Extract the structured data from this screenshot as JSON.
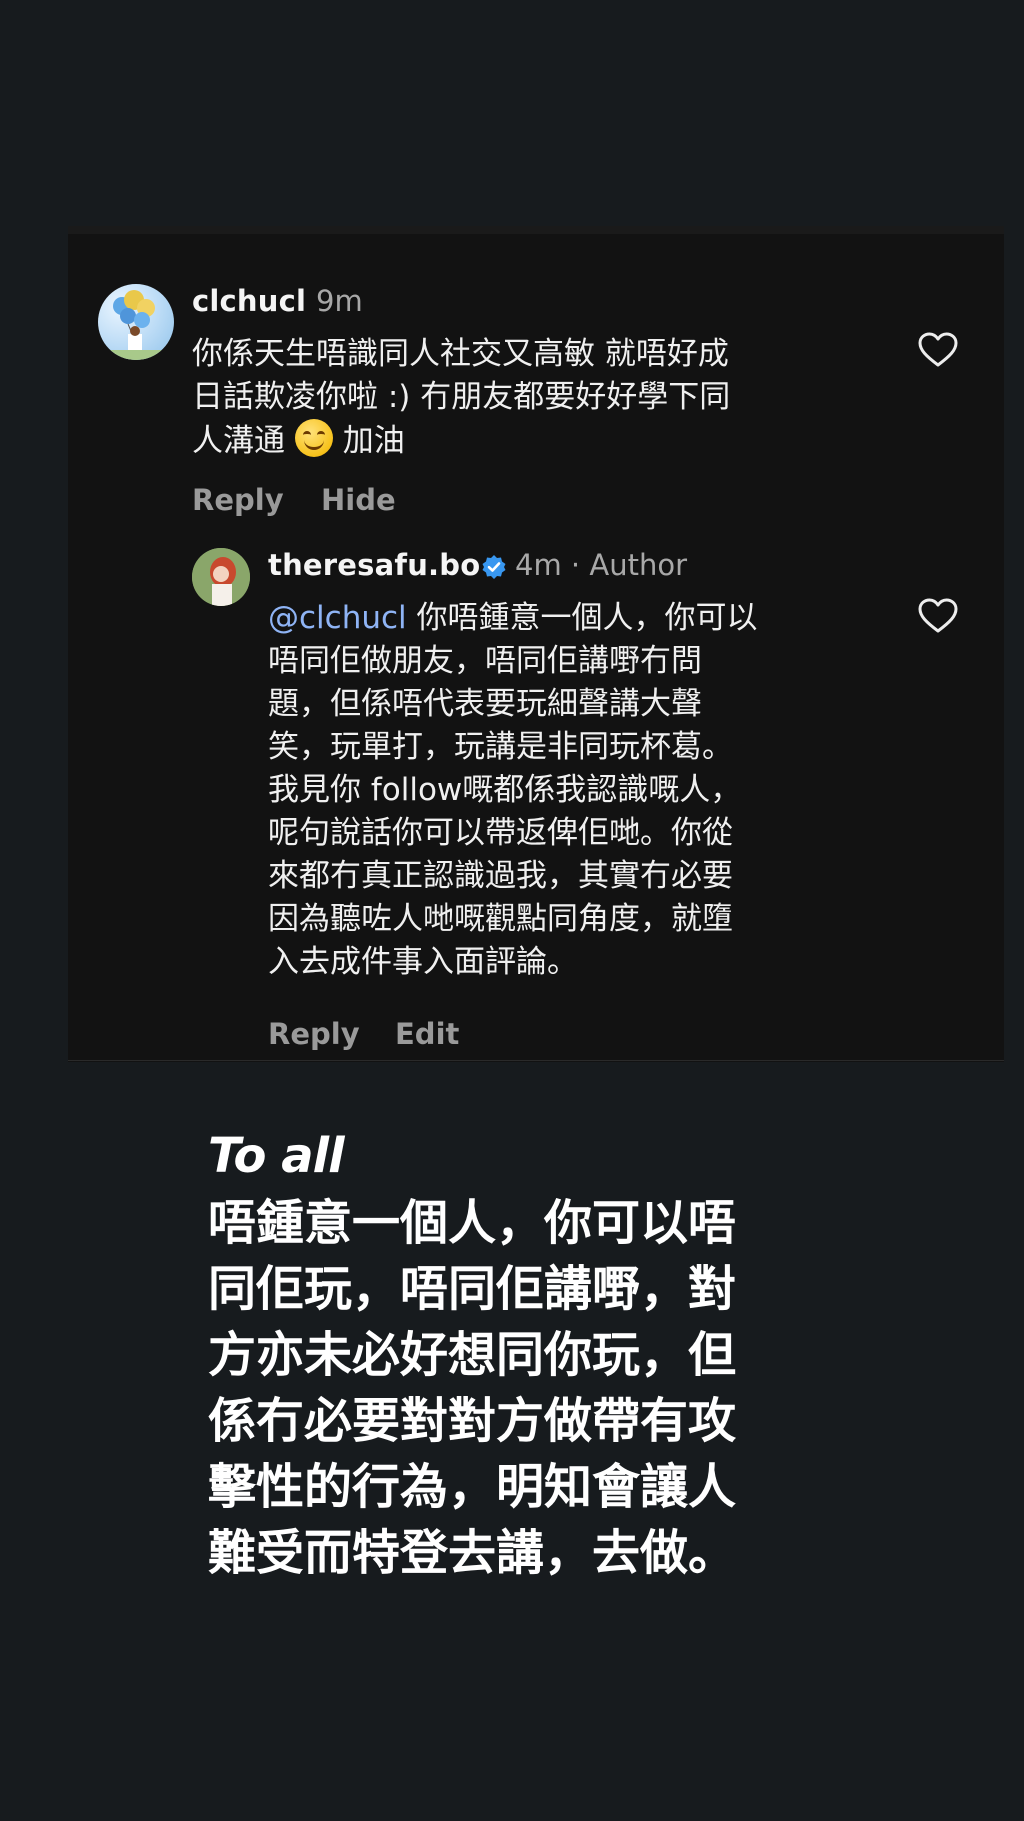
{
  "comments": [
    {
      "username": "clchucl",
      "time": "9m",
      "lines": [
        "你係天生唔識同人社交又高敏 就唔好成",
        "日話欺凌你啦 :) 冇朋友都要好好學下同",
        "人溝通",
        "加油"
      ],
      "actions": [
        "Reply",
        "Hide"
      ],
      "avatar_icon": "avatar-icon"
    },
    {
      "username": "theresafu.bo",
      "time": "4m · Author",
      "mention": "@clchucl",
      "text": " 你唔鍾意一個人，你可以\n唔同佢做朋友，唔同佢講嘢冇問\n題，但係唔代表要玩細聲講大聲\n笑，玩單打，玩講是非同玩杯葛。\n我見你 follow嘅都係我認識嘅人，\n呢句說話你可以帶返俾佢哋。你從\n來都冇真正認識過我，其實冇必要\n因為聽咗人哋嘅觀點同角度，就墮\n入去成件事入面評論。",
      "actions": [
        "Reply",
        "Edit"
      ],
      "verified_color": "#3897f0"
    }
  ],
  "story_text": {
    "title": "To all",
    "body": "唔鍾意一個人，你可以唔\n同佢玩，唔同佢講嘢，對\n方亦未必好想同你玩，但\n係冇必要對對方做帶有攻\n擊性的行為，明知會讓人\n難受而特登去講，去做。"
  },
  "colors": {
    "background": "#171b1e",
    "card": "#121212",
    "mention": "#8fb4f5",
    "muted": "#9a9a9a"
  }
}
